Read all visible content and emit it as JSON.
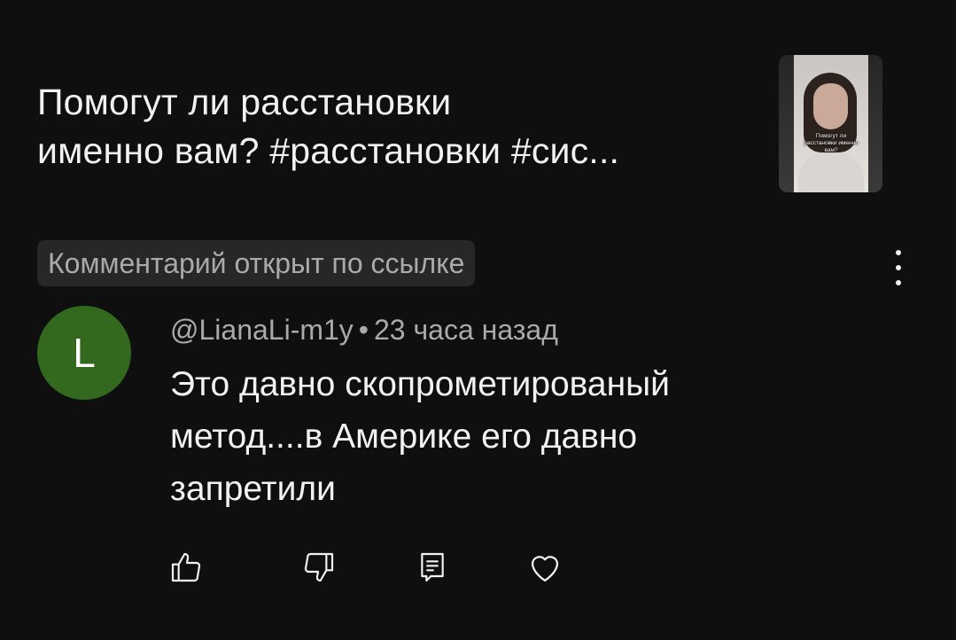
{
  "video": {
    "title_line1": "Помогут ли расстановки",
    "title_line2": "именно вам? #расстановки #сис...",
    "thumbnail": {
      "caption_line1": "Помогут ли",
      "caption_line2": "расстановки именно",
      "caption_line3": "вам?"
    }
  },
  "comment_link_badge": "Комментарий открыт по ссылке",
  "comment": {
    "avatar_letter": "L",
    "avatar_color": "#33691e",
    "author": "@LianaLi-m1y",
    "separator": "•",
    "time": "23 часа назад",
    "text_line1": "Это давно скопрометированый",
    "text_line2": "метод....в Америке его давно",
    "text_line3": "запретили"
  },
  "actions": [
    {
      "icon": "like-icon"
    },
    {
      "icon": "dislike-icon"
    },
    {
      "icon": "reply-icon"
    },
    {
      "icon": "heart-icon"
    }
  ],
  "menu": {
    "icon": "more-vert-icon"
  }
}
